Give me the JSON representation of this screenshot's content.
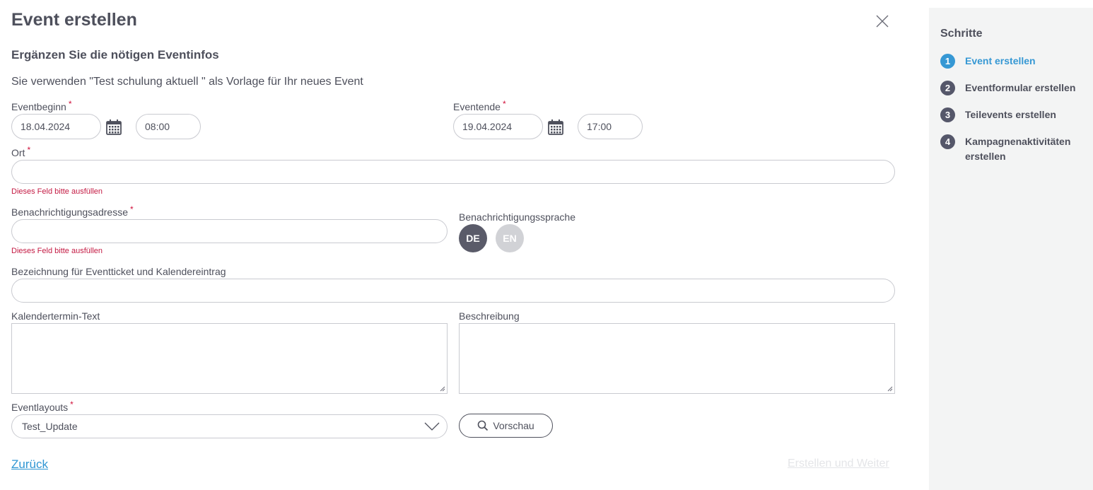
{
  "header": {
    "title": "Event erstellen",
    "subtitle": "Ergänzen Sie die nötigen Eventinfos",
    "template_info": "Sie verwenden \"Test schulung aktuell \" als Vorlage für Ihr neues Event"
  },
  "form": {
    "required_mark": "*",
    "start": {
      "label": "Eventbeginn",
      "date": "18.04.2024",
      "time": "08:00"
    },
    "end": {
      "label": "Eventende",
      "date": "19.04.2024",
      "time": "17:00"
    },
    "location": {
      "label": "Ort",
      "value": "",
      "error": "Dieses Feld bitte ausfüllen"
    },
    "notification_address": {
      "label": "Benachrichtigungsadresse",
      "value": "",
      "error": "Dieses Feld bitte ausfüllen"
    },
    "notification_language": {
      "label": "Benachrichtigungssprache",
      "options": [
        "DE",
        "EN"
      ],
      "selected": "DE"
    },
    "ticket_name": {
      "label": "Bezeichnung für Eventticket und Kalendereintrag",
      "value": ""
    },
    "calendar_text": {
      "label": "Kalendertermin-Text",
      "value": ""
    },
    "description": {
      "label": "Beschreibung",
      "value": ""
    },
    "layout": {
      "label": "Eventlayouts",
      "value": "Test_Update"
    },
    "preview_label": "Vorschau"
  },
  "footer": {
    "back_label": "Zurück",
    "create_label": "Erstellen und Weiter"
  },
  "sidebar": {
    "title": "Schritte",
    "steps": [
      {
        "number": "1",
        "label": "Event erstellen",
        "active": true
      },
      {
        "number": "2",
        "label": "Eventformular erstellen",
        "active": false
      },
      {
        "number": "3",
        "label": "Teilevents erstellen",
        "active": false
      },
      {
        "number": "4",
        "label": "Kampagnenaktivitäten erstellen",
        "active": false
      }
    ]
  },
  "colors": {
    "accent": "#3698d4",
    "error": "#c41a43",
    "text": "#4e505c",
    "sidebar_bg": "#f3f4f4"
  }
}
